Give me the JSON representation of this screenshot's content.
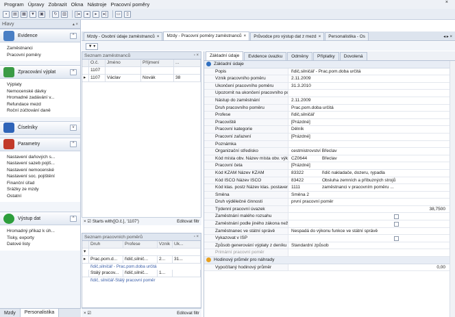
{
  "menu": [
    "Program",
    "Úpravy",
    "Zobrazit",
    "Okna",
    "Nástroje",
    "Pracovní poměry"
  ],
  "menu_close": "×",
  "toolbar": [
    "save",
    "open",
    "print",
    "filter",
    "export",
    "refresh",
    "first",
    "prev",
    "next",
    "last",
    "sep",
    "report",
    "doc"
  ],
  "left": {
    "header": "Hlavy",
    "groups": [
      {
        "label": "Evidence",
        "color": "#4a7fc4",
        "items": [
          "Zaměstnanci",
          "Pracovní poměry"
        ]
      },
      {
        "label": "Zpracování výplat",
        "color": "#3a9b45",
        "items": [
          "Výplaty",
          "Nemocenské dávky",
          "Hromadné zadávání v...",
          "Refundace mezd",
          "Roční zúčtování daně"
        ]
      },
      {
        "label": "Číselníky",
        "color": "#2f64b8",
        "items": []
      },
      {
        "label": "Parametry",
        "color": "#c23a2a",
        "items": [
          "Nastavení daňových s...",
          "Nastavení sazeb pojiš...",
          "Nastavení nemocenské",
          "Nastavení soc. pojištění",
          "Finanční úřad",
          "Sráżky ze mzdy",
          "Ostatní"
        ]
      },
      {
        "label": "Výstup dat",
        "color": "#2d9e3c",
        "items": [
          "Hromadný příkaz k úh...",
          "Tisky, exporty",
          "Datové listy"
        ]
      }
    ],
    "tabs": [
      "Mzdy",
      "Personalistika"
    ]
  },
  "doc_tabs": [
    {
      "label": "Mzdy - Osobní údaje zaměstnanců",
      "active": false
    },
    {
      "label": "Mzdy - Pracovní poměry zaměstnanců",
      "active": true
    },
    {
      "label": "Průvodce pro výstup dat z mezd",
      "active": false
    },
    {
      "label": "Personalistika - Os",
      "active": false
    }
  ],
  "doc_nav": "◂  ▸  ×",
  "employees": {
    "title": "Seznam zaměstnanců",
    "columns": [
      "O.č.",
      "Jméno",
      "Příjmení",
      "..."
    ],
    "rows": [
      {
        "marker": "",
        "oc": "1107",
        "jmeno": "",
        "prijmeni": "",
        "extra": ""
      },
      {
        "marker": "▸",
        "oc": "1107",
        "jmeno": "Václav",
        "prijmeni": "Novák",
        "extra": "38"
      }
    ],
    "filter": "Starts with([O.č.], '1107')",
    "filter_edit": "Editovat filtr"
  },
  "positions": {
    "title": "Seznam pracovních poměrů",
    "columns": [
      "Druh",
      "Profese",
      "Vznik",
      "Uk..."
    ],
    "rows": [
      {
        "druh": "Prac.pom.d...",
        "profese": "řidič,silnič...",
        "vznik": "2...",
        "uk": "31...",
        "sub": "řidič,silničář - Prac.pom.doba určitá"
      },
      {
        "druh": "Stálý pracov...",
        "profese": "řidič,silnič...",
        "vznik": "1...",
        "uk": "",
        "sub": "řidič, silničář-Stálý pracovní poměr"
      }
    ],
    "filter_edit": "Editovat filtr"
  },
  "detail": {
    "tabs": [
      "Základní údaje",
      "Evidence úvazku",
      "Odměny",
      "Příplatky",
      "Dovolená"
    ],
    "sections": [
      {
        "title": "Základní údaje",
        "color": "#2f6fc0",
        "rows": [
          [
            "Popis",
            "řidič,silničář - Prac.pom.doba určitá"
          ],
          [
            "Vznik pracovního poměru",
            "2.11.2009"
          ],
          [
            "Ukončení pracovního poměru",
            "31.3.2010"
          ],
          [
            "Upozornit na ukončení pracovního poměru",
            ""
          ],
          [
            "Nástup do zaměstnání",
            "2.11.2009"
          ],
          [
            "Druh pracovního poměru",
            "Prac.pom.doba určitá"
          ],
          [
            "Profese",
            "řidič,silničář"
          ],
          [
            "Pracoviště",
            "[Prázdné]"
          ],
          [
            "Pracovní kategorie",
            "Dělník"
          ],
          [
            "Pracovní zařazení",
            "[Prázdné]"
          ],
          [
            "Poznámka",
            ""
          ],
          [
            "Organizační středisko",
            "cestmistrovství Břeclav"
          ],
          [
            "Kód místa obv.  Název místa obv. výkonu prá",
            "CZ0644",
            "Břeclav"
          ],
          [
            "Pracovní četa",
            "[Prázdné]"
          ],
          [
            "Kód KZAM       Název KZAM",
            "83322",
            "řidič nakladače, dozeru, rypadla"
          ],
          [
            "Kód ISCO        Název ISCO",
            "83422",
            "Obsluha zemních a příbuzných strojů"
          ],
          [
            "Kód klas. postz Název klas. postavení v zam.",
            "1111",
            "zaměstnanci v pracovním poměru ..."
          ],
          [
            "Směna",
            "Směna 2"
          ],
          [
            "Druh výdělečné činnosti",
            "první pracovní poměr"
          ],
          [
            "Týdenní pracovní úvazek",
            "38,7500"
          ],
          [
            "Zaměstnání malého rozsahu",
            "☐"
          ],
          [
            "Zaměstnání podle jiného zákona než podle zá",
            "☐"
          ],
          [
            "Zaměstnanec ve státní správě",
            "Nespadá do výkonu funkce ve státní správě"
          ],
          [
            "Vykazovat v ISP",
            "☐"
          ],
          [
            "Způsob generování výplaty z deníku",
            "Standardní způsob"
          ],
          [
            "Primární pracovní poměr",
            ""
          ]
        ]
      },
      {
        "title": "Hodinový průměr pro náhrady",
        "color": "#e8a020",
        "rows": [
          [
            "Vypočítaný hodinový průměr",
            "0,00"
          ]
        ]
      }
    ]
  }
}
